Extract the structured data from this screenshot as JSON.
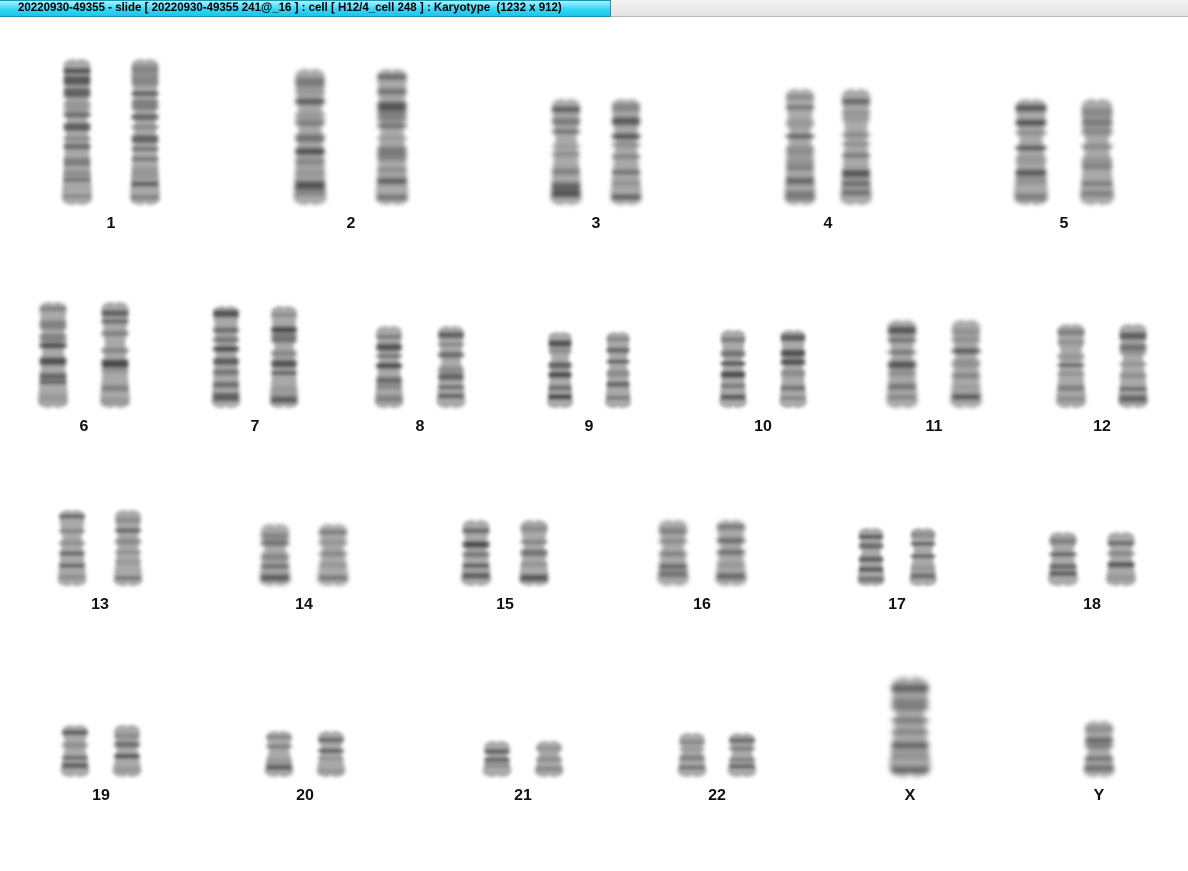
{
  "window": {
    "title": "20220930-49355 - slide [ 20220930-49355 241@_16 ] : cell [ H12/4_cell 248 ] : Karyotype  (1232 x 912)"
  },
  "karyotype": {
    "labels": [
      "1",
      "2",
      "3",
      "4",
      "5",
      "6",
      "7",
      "8",
      "9",
      "10",
      "11",
      "12",
      "13",
      "14",
      "15",
      "16",
      "17",
      "18",
      "19",
      "20",
      "21",
      "22",
      "X",
      "Y"
    ]
  }
}
